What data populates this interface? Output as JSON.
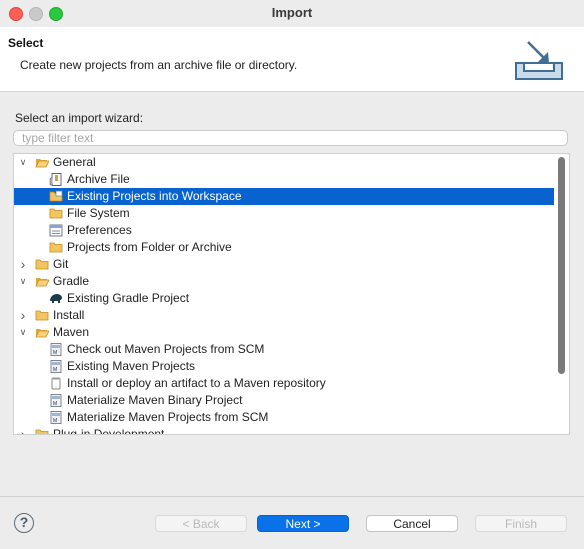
{
  "window": {
    "title": "Import"
  },
  "header": {
    "title": "Select",
    "description": "Create new projects from an archive file or directory."
  },
  "wizard": {
    "label": "Select an import wizard:",
    "filter_placeholder": "type filter text"
  },
  "tree": [
    {
      "label": "General",
      "level": 0,
      "expanded": true,
      "icon": "folder-open-icon"
    },
    {
      "label": "Archive File",
      "level": 1,
      "icon": "archive-file-icon"
    },
    {
      "label": "Existing Projects into Workspace",
      "level": 1,
      "icon": "projects-folder-icon",
      "selected": true
    },
    {
      "label": "File System",
      "level": 1,
      "icon": "folder-icon"
    },
    {
      "label": "Preferences",
      "level": 1,
      "icon": "preferences-icon"
    },
    {
      "label": "Projects from Folder or Archive",
      "level": 1,
      "icon": "folder-icon"
    },
    {
      "label": "Git",
      "level": 0,
      "expanded": false,
      "icon": "folder-icon"
    },
    {
      "label": "Gradle",
      "level": 0,
      "expanded": true,
      "icon": "folder-open-icon"
    },
    {
      "label": "Existing Gradle Project",
      "level": 1,
      "icon": "gradle-elephant-icon"
    },
    {
      "label": "Install",
      "level": 0,
      "expanded": false,
      "icon": "folder-icon"
    },
    {
      "label": "Maven",
      "level": 0,
      "expanded": true,
      "icon": "folder-open-icon"
    },
    {
      "label": "Check out Maven Projects from SCM",
      "level": 1,
      "icon": "maven-icon"
    },
    {
      "label": "Existing Maven Projects",
      "level": 1,
      "icon": "maven-icon"
    },
    {
      "label": "Install or deploy an artifact to a Maven repository",
      "level": 1,
      "icon": "jar-icon"
    },
    {
      "label": "Materialize Maven Binary Project",
      "level": 1,
      "icon": "maven-icon"
    },
    {
      "label": "Materialize Maven Projects from SCM",
      "level": 1,
      "icon": "maven-icon"
    },
    {
      "label": "Plug-in Development",
      "level": 0,
      "expanded": false,
      "icon": "folder-icon"
    }
  ],
  "buttons": {
    "back": "< Back",
    "next": "Next >",
    "cancel": "Cancel",
    "finish": "Finish",
    "help": "?"
  },
  "colors": {
    "selection": "#0863d0",
    "primary_button": "#0a72e8",
    "folder": "#e8b448"
  }
}
